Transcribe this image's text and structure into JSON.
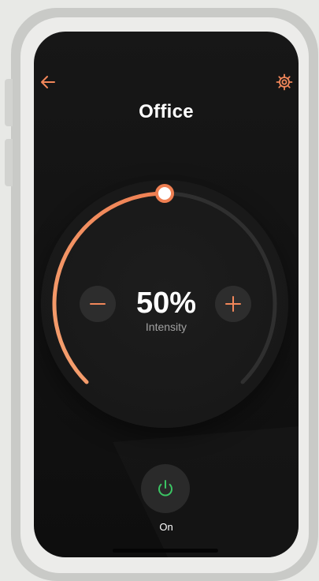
{
  "colors": {
    "accent": "#f2875a",
    "accent_light": "#f7a071",
    "power_on": "#3bc463",
    "track": "#2f2f2f"
  },
  "header": {
    "title": "Office",
    "back_icon": "arrow-left-icon",
    "settings_icon": "gear-icon"
  },
  "dial": {
    "value_percent": 50,
    "value_text": "50%",
    "label": "Intensity",
    "minus_icon": "minus-icon",
    "plus_icon": "plus-icon"
  },
  "power": {
    "icon": "power-icon",
    "label": "On",
    "state": "on"
  }
}
